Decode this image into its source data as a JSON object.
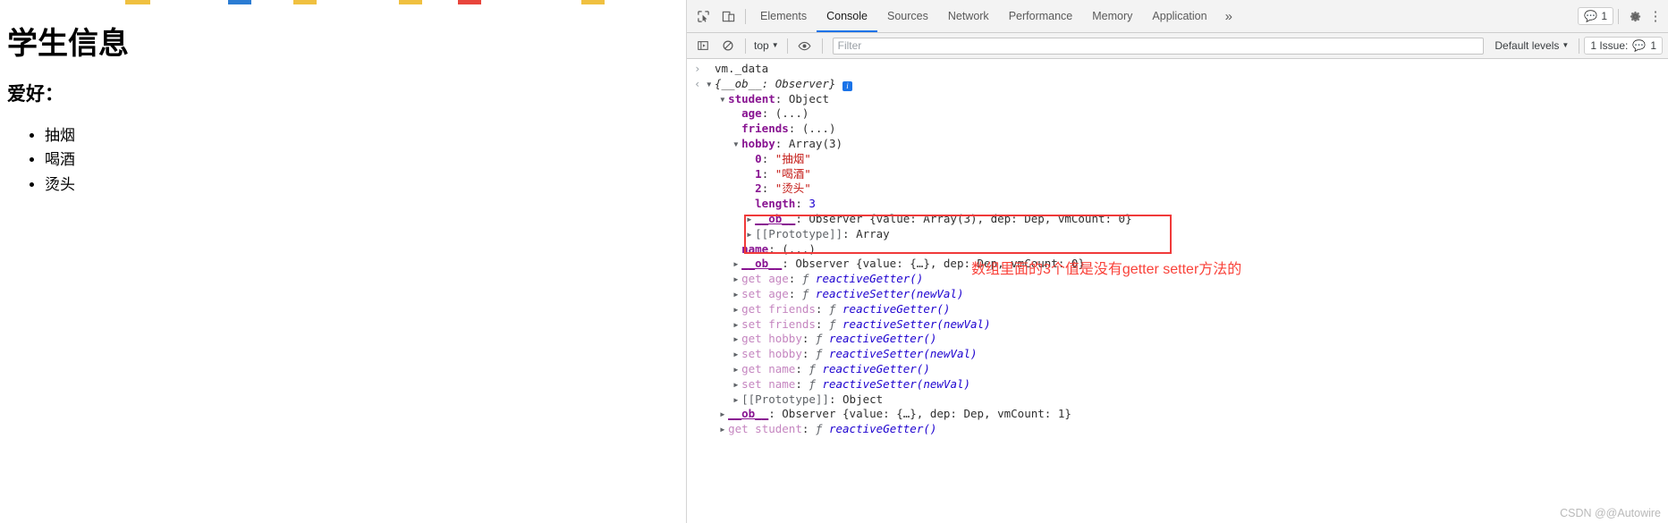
{
  "page": {
    "title": "学生信息",
    "subtitle": "爱好：",
    "hobbies": [
      "抽烟",
      "喝酒",
      "烫头"
    ]
  },
  "devtools": {
    "tabs": [
      {
        "label": "Elements",
        "active": false
      },
      {
        "label": "Console",
        "active": true
      },
      {
        "label": "Sources",
        "active": false
      },
      {
        "label": "Network",
        "active": false
      },
      {
        "label": "Performance",
        "active": false
      },
      {
        "label": "Memory",
        "active": false
      },
      {
        "label": "Application",
        "active": false
      }
    ],
    "more_tabs_label": "»",
    "message_count": "1",
    "toolbar": {
      "context_label": "top",
      "filter_placeholder": "Filter",
      "levels_label": "Default levels",
      "issues_label": "1 Issue:",
      "issues_count": "1"
    }
  },
  "console": {
    "input": "vm._data",
    "lines": [
      {
        "indent": 0,
        "gutter": "in",
        "tri": "",
        "text": "vm._data",
        "type": "plain"
      },
      {
        "indent": 0,
        "gutter": "out",
        "tri": "down",
        "text": "{__ob__: Observer}",
        "type": "objhead"
      },
      {
        "indent": 1,
        "gutter": "",
        "tri": "down",
        "key": "student",
        "sep": ": ",
        "val": "Object",
        "type": "prop"
      },
      {
        "indent": 2,
        "gutter": "",
        "tri": "",
        "key": "age",
        "sep": ": ",
        "val": "(...)",
        "type": "prop"
      },
      {
        "indent": 2,
        "gutter": "",
        "tri": "",
        "key": "friends",
        "sep": ": ",
        "val": "(...)",
        "type": "prop"
      },
      {
        "indent": 2,
        "gutter": "",
        "tri": "down",
        "key": "hobby",
        "sep": ": ",
        "val": "Array(3)",
        "type": "prop"
      },
      {
        "indent": 3,
        "gutter": "",
        "tri": "",
        "key": "0",
        "sep": ": ",
        "val": "\"抽烟\"",
        "type": "index"
      },
      {
        "indent": 3,
        "gutter": "",
        "tri": "",
        "key": "1",
        "sep": ": ",
        "val": "\"喝酒\"",
        "type": "index"
      },
      {
        "indent": 3,
        "gutter": "",
        "tri": "",
        "key": "2",
        "sep": ": ",
        "val": "\"烫头\"",
        "type": "index"
      },
      {
        "indent": 3,
        "gutter": "",
        "tri": "",
        "key": "length",
        "sep": ": ",
        "val": "3",
        "type": "num"
      },
      {
        "indent": 3,
        "gutter": "",
        "tri": "right",
        "key": "__ob__",
        "sep": ": ",
        "val": "Observer {value: Array(3), dep: Dep, vmCount: 0}",
        "type": "observer"
      },
      {
        "indent": 3,
        "gutter": "",
        "tri": "right",
        "key": "[[Prototype]]",
        "sep": ": ",
        "val": "Array",
        "type": "proto"
      },
      {
        "indent": 2,
        "gutter": "",
        "tri": "",
        "key": "name",
        "sep": ": ",
        "val": "(...)",
        "type": "prop"
      },
      {
        "indent": 2,
        "gutter": "",
        "tri": "right",
        "key": "__ob__",
        "sep": ": ",
        "val": "Observer {value: {…}, dep: Dep, vmCount: 0}",
        "type": "observer"
      },
      {
        "indent": 2,
        "gutter": "",
        "tri": "right",
        "key": "get age",
        "sep": ": ",
        "val": "reactiveGetter()",
        "type": "accessor"
      },
      {
        "indent": 2,
        "gutter": "",
        "tri": "right",
        "key": "set age",
        "sep": ": ",
        "val": "reactiveSetter(newVal)",
        "type": "accessor"
      },
      {
        "indent": 2,
        "gutter": "",
        "tri": "right",
        "key": "get friends",
        "sep": ": ",
        "val": "reactiveGetter()",
        "type": "accessor"
      },
      {
        "indent": 2,
        "gutter": "",
        "tri": "right",
        "key": "set friends",
        "sep": ": ",
        "val": "reactiveSetter(newVal)",
        "type": "accessor"
      },
      {
        "indent": 2,
        "gutter": "",
        "tri": "right",
        "key": "get hobby",
        "sep": ": ",
        "val": "reactiveGetter()",
        "type": "accessor"
      },
      {
        "indent": 2,
        "gutter": "",
        "tri": "right",
        "key": "set hobby",
        "sep": ": ",
        "val": "reactiveSetter(newVal)",
        "type": "accessor"
      },
      {
        "indent": 2,
        "gutter": "",
        "tri": "right",
        "key": "get name",
        "sep": ": ",
        "val": "reactiveGetter()",
        "type": "accessor"
      },
      {
        "indent": 2,
        "gutter": "",
        "tri": "right",
        "key": "set name",
        "sep": ": ",
        "val": "reactiveSetter(newVal)",
        "type": "accessor"
      },
      {
        "indent": 2,
        "gutter": "",
        "tri": "right",
        "key": "[[Prototype]]",
        "sep": ": ",
        "val": "Object",
        "type": "proto"
      },
      {
        "indent": 1,
        "gutter": "",
        "tri": "right",
        "key": "__ob__",
        "sep": ": ",
        "val": "Observer {value: {…}, dep: Dep, vmCount: 1}",
        "type": "observer"
      },
      {
        "indent": 1,
        "gutter": "",
        "tri": "right",
        "key": "get student",
        "sep": ": ",
        "val": "reactiveGetter()",
        "type": "accessor"
      }
    ]
  },
  "annotation": {
    "text": "数组里面的3个值是没有getter setter方法的",
    "color": "#f9423a"
  },
  "watermark": "CSDN @@Autowire"
}
